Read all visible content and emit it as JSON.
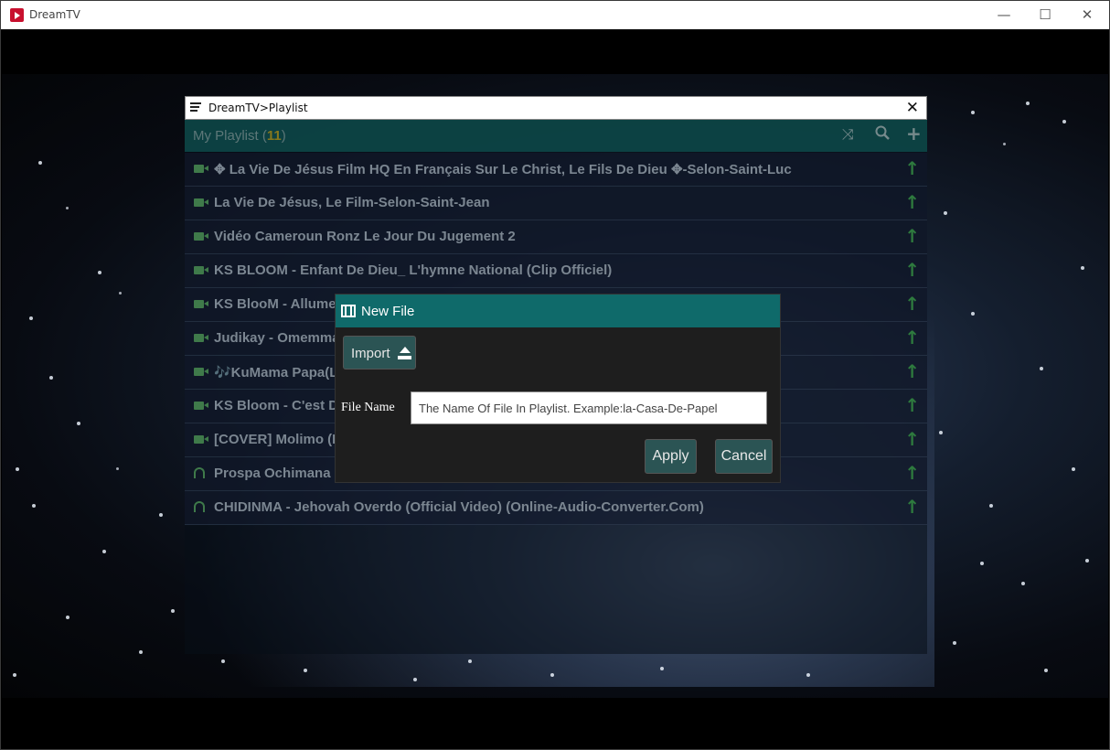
{
  "app": {
    "title": "DreamTV",
    "controls": {
      "minimize": "—",
      "maximize": "☐",
      "close": "✕"
    }
  },
  "playlist_window": {
    "title": "DreamTV>Playlist",
    "close": "✕",
    "header": {
      "label": "My Playlist",
      "count": "11",
      "icons": [
        "shuffle-icon",
        "search-icon",
        "plus-icon"
      ]
    },
    "items": [
      {
        "type": "video",
        "title": "✥ La Vie De Jésus Film HQ En Français Sur Le Christ, Le Fils De Dieu ✥-Selon-Saint-Luc"
      },
      {
        "type": "video",
        "title": "La Vie De Jésus, Le Film-Selon-Saint-Jean"
      },
      {
        "type": "video",
        "title": "Vidéo Cameroun Ronz Le Jour Du Jugement 2"
      },
      {
        "type": "video",
        "title": "KS BLOOM - Enfant De Dieu_ L'hymne National (Clip Officiel)"
      },
      {
        "type": "video",
        "title": "KS BlooM - Allumez"
      },
      {
        "type": "video",
        "title": "Judikay - Omemma"
      },
      {
        "type": "video",
        "title": "🎶KuMama Papa(Li"
      },
      {
        "type": "video",
        "title": "KS Bloom - C'est Dieu"
      },
      {
        "type": "video",
        "title": "[COVER] Molimo (Liv"
      },
      {
        "type": "audio",
        "title": "Prospa Ochimana - Ekwueme Feat Osinach"
      },
      {
        "type": "audio",
        "title": "CHIDINMA - Jehovah Overdo (Official Video) (Online-Audio-Converter.Com)"
      }
    ],
    "item_action": "↑"
  },
  "dialog": {
    "title": "New File",
    "import_label": "Import",
    "file_name_label": "File Name",
    "file_name_placeholder": "The Name Of File In Playlist. Example:la-Casa-De-Papel",
    "apply_label": "Apply",
    "cancel_label": "Cancel"
  },
  "colors": {
    "header_teal": "#0d4a4a",
    "dialog_teal": "#0f6a6a",
    "button_teal": "#2b5454",
    "count_yellow": "#9c8a1e",
    "arrow_green": "#2e7a3e"
  }
}
